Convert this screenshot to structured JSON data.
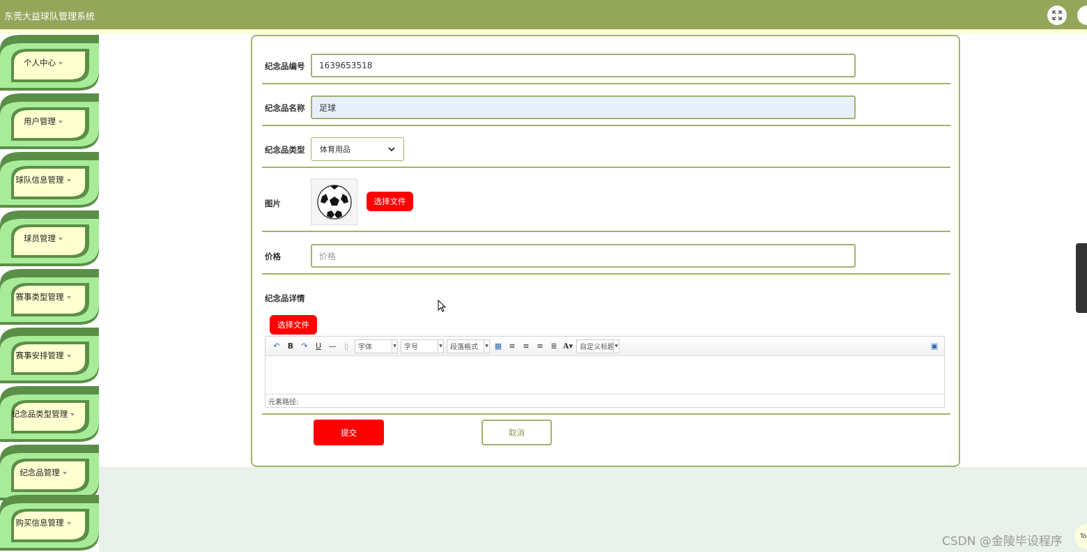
{
  "header": {
    "title": "东莞大益球队管理系统"
  },
  "sidebar": {
    "items": [
      {
        "label": "个人中心"
      },
      {
        "label": "用户管理"
      },
      {
        "label": "球队信息管理"
      },
      {
        "label": "球员管理"
      },
      {
        "label": "赛事类型管理"
      },
      {
        "label": "赛事安排管理"
      },
      {
        "label": "纪念品类型管理"
      },
      {
        "label": "纪念品管理"
      },
      {
        "label": "购买信息管理"
      }
    ]
  },
  "form": {
    "code_label": "纪念品编号",
    "code_value": "1639653518",
    "name_label": "纪念品名称",
    "name_value": "足球",
    "type_label": "纪念品类型",
    "type_value": "体育用品",
    "image_label": "图片",
    "image_button": "选择文件",
    "price_label": "价格",
    "price_placeholder": "价格",
    "detail_label": "纪念品详情",
    "detail_button": "选择文件",
    "submit": "提交",
    "cancel": "取消"
  },
  "editor": {
    "font_family": "字体",
    "font_size": "字号",
    "paragraph": "段落格式",
    "custom_title": "自定义标题",
    "element_path": "元素路径:"
  },
  "watermark": "CSDN @金陵毕设程序",
  "corner_text": "To",
  "colors": {
    "header": "#93a65a",
    "accent_green": "#9fb36a",
    "button_red": "#ff0000"
  }
}
